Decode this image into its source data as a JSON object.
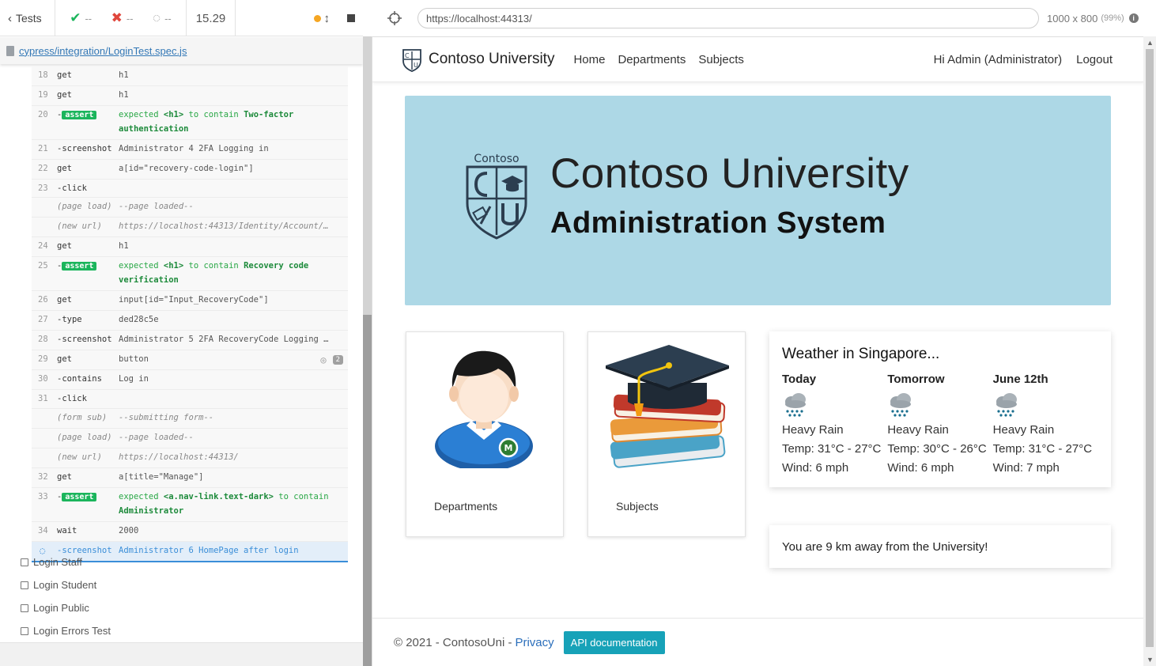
{
  "runner": {
    "tests_label": "Tests",
    "passed": "--",
    "failed": "--",
    "pending": "--",
    "duration": "15.29",
    "spec_path": "cypress/integration/LoginTest.spec.js",
    "commands": [
      {
        "num": "18",
        "name": "get",
        "msg": "h1",
        "kind": "normal"
      },
      {
        "num": "19",
        "name": "get",
        "msg": "h1",
        "kind": "normal"
      },
      {
        "num": "20",
        "name": "assert",
        "msg_parts": [
          "expected ",
          "<h1>",
          " to contain ",
          "Two-factor authentication"
        ],
        "kind": "assert"
      },
      {
        "num": "21",
        "name": "-screenshot",
        "msg": "Administrator 4 2FA Logging in",
        "kind": "normal"
      },
      {
        "num": "22",
        "name": "get",
        "msg": "a[id=\"recovery-code-login\"]",
        "kind": "normal"
      },
      {
        "num": "23",
        "name": "-click",
        "msg": "",
        "kind": "normal"
      },
      {
        "num": "",
        "name": "(page load)",
        "msg": "--page loaded--",
        "kind": "event"
      },
      {
        "num": "",
        "name": "(new url)",
        "msg": "https://localhost:44313/Identity/Account/…",
        "kind": "event"
      },
      {
        "num": "24",
        "name": "get",
        "msg": "h1",
        "kind": "normal"
      },
      {
        "num": "25",
        "name": "assert",
        "msg_parts": [
          "expected ",
          "<h1>",
          " to contain ",
          "Recovery code verification"
        ],
        "kind": "assert"
      },
      {
        "num": "26",
        "name": "get",
        "msg": "input[id=\"Input_RecoveryCode\"]",
        "kind": "normal"
      },
      {
        "num": "27",
        "name": "-type",
        "msg": "ded28c5e",
        "kind": "normal"
      },
      {
        "num": "28",
        "name": "-screenshot",
        "msg": "Administrator 5 2FA RecoveryCode Logging …",
        "kind": "normal"
      },
      {
        "num": "29",
        "name": "get",
        "msg": "button",
        "kind": "normal",
        "count": "2"
      },
      {
        "num": "30",
        "name": "-contains",
        "msg": "Log in",
        "kind": "normal"
      },
      {
        "num": "31",
        "name": "-click",
        "msg": "",
        "kind": "normal"
      },
      {
        "num": "",
        "name": "(form sub)",
        "msg": "--submitting form--",
        "kind": "event"
      },
      {
        "num": "",
        "name": "(page load)",
        "msg": "--page loaded--",
        "kind": "event"
      },
      {
        "num": "",
        "name": "(new url)",
        "msg": "https://localhost:44313/",
        "kind": "event"
      },
      {
        "num": "32",
        "name": "get",
        "msg": "a[title=\"Manage\"]",
        "kind": "normal"
      },
      {
        "num": "33",
        "name": "assert",
        "msg_parts": [
          "expected ",
          "<a.nav-link.text-dark>",
          " to contain ",
          "Administrator"
        ],
        "kind": "assert"
      },
      {
        "num": "34",
        "name": "wait",
        "msg": "2000",
        "kind": "normal"
      },
      {
        "num": "",
        "name": "-screenshot",
        "msg": "Administrator 6 HomePage after login",
        "kind": "active"
      }
    ],
    "other_tests": [
      "Login Staff",
      "Login Student",
      "Login Public",
      "Login Errors Test"
    ]
  },
  "browser": {
    "url": "https://localhost:44313/",
    "viewport": "1000 x 800",
    "zoom": "(99%)"
  },
  "app": {
    "brand": "Contoso University",
    "logo_text": "Contoso",
    "nav": [
      "Home",
      "Departments",
      "Subjects"
    ],
    "user_greeting": "Hi Admin (Administrator)",
    "logout": "Logout",
    "banner_title": "Contoso University",
    "banner_subtitle": "Administration System",
    "cards": [
      {
        "label": "Departments"
      },
      {
        "label": "Subjects"
      }
    ],
    "weather": {
      "title": "Weather in Singapore...",
      "days": [
        {
          "name": "Today",
          "condition": "Heavy Rain",
          "temp": "Temp: 31°C - 27°C",
          "wind": "Wind: 6 mph"
        },
        {
          "name": "Tomorrow",
          "condition": "Heavy Rain",
          "temp": "Temp: 30°C - 26°C",
          "wind": "Wind: 6 mph"
        },
        {
          "name": "June 12th",
          "condition": "Heavy Rain",
          "temp": "Temp: 31°C - 27°C",
          "wind": "Wind: 7 mph"
        }
      ]
    },
    "distance": "You are 9 km away from the University!",
    "footer": {
      "copyright": "© 2021 - ContosoUni -",
      "privacy": "Privacy",
      "api_button": "API documentation"
    }
  },
  "colors": {
    "banner_bg": "#add8e6",
    "assert_green": "#1bb55c",
    "api_button": "#17a2b8",
    "link_blue": "#2a6ebb"
  }
}
